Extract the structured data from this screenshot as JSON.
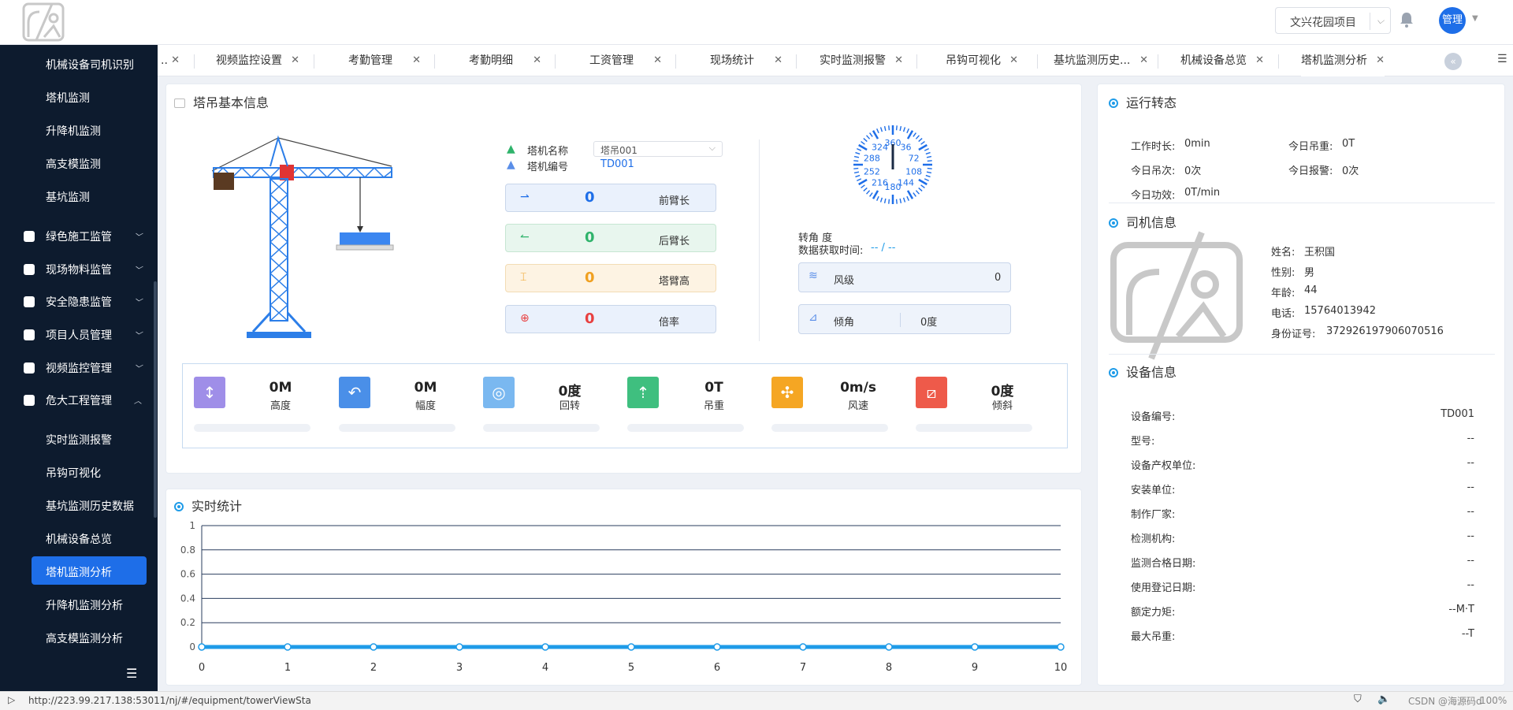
{
  "header": {
    "project": "文兴花园项目",
    "user": "管理"
  },
  "sidebar": {
    "sub_top": [
      "机械设备司机识别",
      "塔机监测",
      "升降机监测",
      "高支模监测",
      "基坑监测"
    ],
    "groups": [
      "绿色施工监管",
      "现场物料监管",
      "安全隐患监管",
      "项目人员管理",
      "视频监控管理",
      "危大工程管理"
    ],
    "sub_bottom": [
      "实时监测报警",
      "吊钩可视化",
      "基坑监测历史数据",
      "机械设备总览",
      "塔机监测分析",
      "升降机监测分析",
      "高支模监测分析"
    ]
  },
  "tabs": [
    {
      "label": "..",
      "active": false
    },
    {
      "label": "视频监控设置",
      "active": false
    },
    {
      "label": "考勤管理",
      "active": false
    },
    {
      "label": "考勤明细",
      "active": false
    },
    {
      "label": "工资管理",
      "active": false
    },
    {
      "label": "现场统计",
      "active": false
    },
    {
      "label": "实时监测报警",
      "active": false
    },
    {
      "label": "吊钩可视化",
      "active": false
    },
    {
      "label": "基坑监测历史...",
      "active": false
    },
    {
      "label": "机械设备总览",
      "active": false
    },
    {
      "label": "塔机监测分析",
      "active": true
    }
  ],
  "basic": {
    "title": "塔吊基本信息",
    "name_label": "塔机名称",
    "name_value": "塔吊001",
    "code_label": "塔机编号",
    "code_value": "TD001",
    "sensors": [
      {
        "value": "0",
        "label": "前臂长",
        "color": "#1e6ee8",
        "bg": "#eaf1fc"
      },
      {
        "value": "0",
        "label": "后臂长",
        "color": "#2fb36b",
        "bg": "#e8f6ee"
      },
      {
        "value": "0",
        "label": "塔臂高",
        "color": "#f0a020",
        "bg": "#fdf3e3"
      },
      {
        "value": "0",
        "label": "倍率",
        "color": "#e84040",
        "bg": "#eaf1fc"
      }
    ],
    "compass_marks": [
      "360",
      "36",
      "72",
      "108",
      "144",
      "180",
      "216",
      "252",
      "288",
      "324"
    ],
    "angle_label": "转角 度",
    "time_label": "数据获取时间:",
    "time_value": "-- / --",
    "wind_label": "风级",
    "wind_value": "0",
    "tilt_label": "倾角",
    "tilt_value": "0度"
  },
  "metrics": [
    {
      "value": "0M",
      "label": "高度",
      "color": "#9f8ee8",
      "icon": "↕"
    },
    {
      "value": "0M",
      "label": "幅度",
      "color": "#4a8fe8",
      "icon": "↶"
    },
    {
      "value": "0度",
      "label": "回转",
      "color": "#7ab8f0",
      "icon": "◎"
    },
    {
      "value": "0T",
      "label": "吊重",
      "color": "#3fbf7f",
      "icon": "⇡"
    },
    {
      "value": "0m/s",
      "label": "风速",
      "color": "#f5a623",
      "icon": "✣"
    },
    {
      "value": "0度",
      "label": "倾斜",
      "color": "#ee5a4a",
      "icon": "⧄"
    }
  ],
  "stats": {
    "title": "实时统计"
  },
  "chart_data": {
    "type": "line",
    "x": [
      0,
      1,
      2,
      3,
      4,
      5,
      6,
      7,
      8,
      9,
      10
    ],
    "series": [
      {
        "values": [
          0,
          0,
          0,
          0,
          0,
          0,
          0,
          0,
          0,
          0,
          0
        ]
      }
    ],
    "yticks": [
      "1",
      "0.8",
      "0.6",
      "0.4",
      "0.2",
      "0"
    ],
    "xticks": [
      "0",
      "1",
      "2",
      "3",
      "4",
      "5",
      "6",
      "7",
      "8",
      "9",
      "10"
    ],
    "ylim": [
      0,
      1
    ],
    "color": "#1e9be8"
  },
  "running": {
    "title": "运行转态",
    "items": [
      {
        "label": "工作时长:",
        "value": "0min"
      },
      {
        "label": "今日吊重:",
        "value": "0T"
      },
      {
        "label": "今日吊次:",
        "value": "0次"
      },
      {
        "label": "今日报警:",
        "value": "0次"
      },
      {
        "label": "今日功效:",
        "value": "0T/min"
      }
    ]
  },
  "driver": {
    "title": "司机信息",
    "items": [
      {
        "label": "姓名:",
        "value": "王积国"
      },
      {
        "label": "性别:",
        "value": "男"
      },
      {
        "label": "年龄:",
        "value": "44"
      },
      {
        "label": "电话:",
        "value": "15764013942"
      },
      {
        "label": "身份证号:",
        "value": "372926197906070516"
      }
    ]
  },
  "device": {
    "title": "设备信息",
    "items": [
      {
        "label": "设备编号:",
        "value": "TD001"
      },
      {
        "label": "型号:",
        "value": "--"
      },
      {
        "label": "设备产权单位:",
        "value": "--"
      },
      {
        "label": "安装单位:",
        "value": "--"
      },
      {
        "label": "制作厂家:",
        "value": "--"
      },
      {
        "label": "检测机构:",
        "value": "--"
      },
      {
        "label": "监测合格日期:",
        "value": "--"
      },
      {
        "label": "使用登记日期:",
        "value": "--"
      },
      {
        "label": "额定力矩:",
        "value": "--M·T"
      },
      {
        "label": "最大吊重:",
        "value": "--T"
      }
    ]
  },
  "statusbar": {
    "url": "http://223.99.217.138:53011/nj/#/equipment/towerViewSta",
    "watermark": "CSDN @海源码d",
    "zoom": "100%"
  }
}
